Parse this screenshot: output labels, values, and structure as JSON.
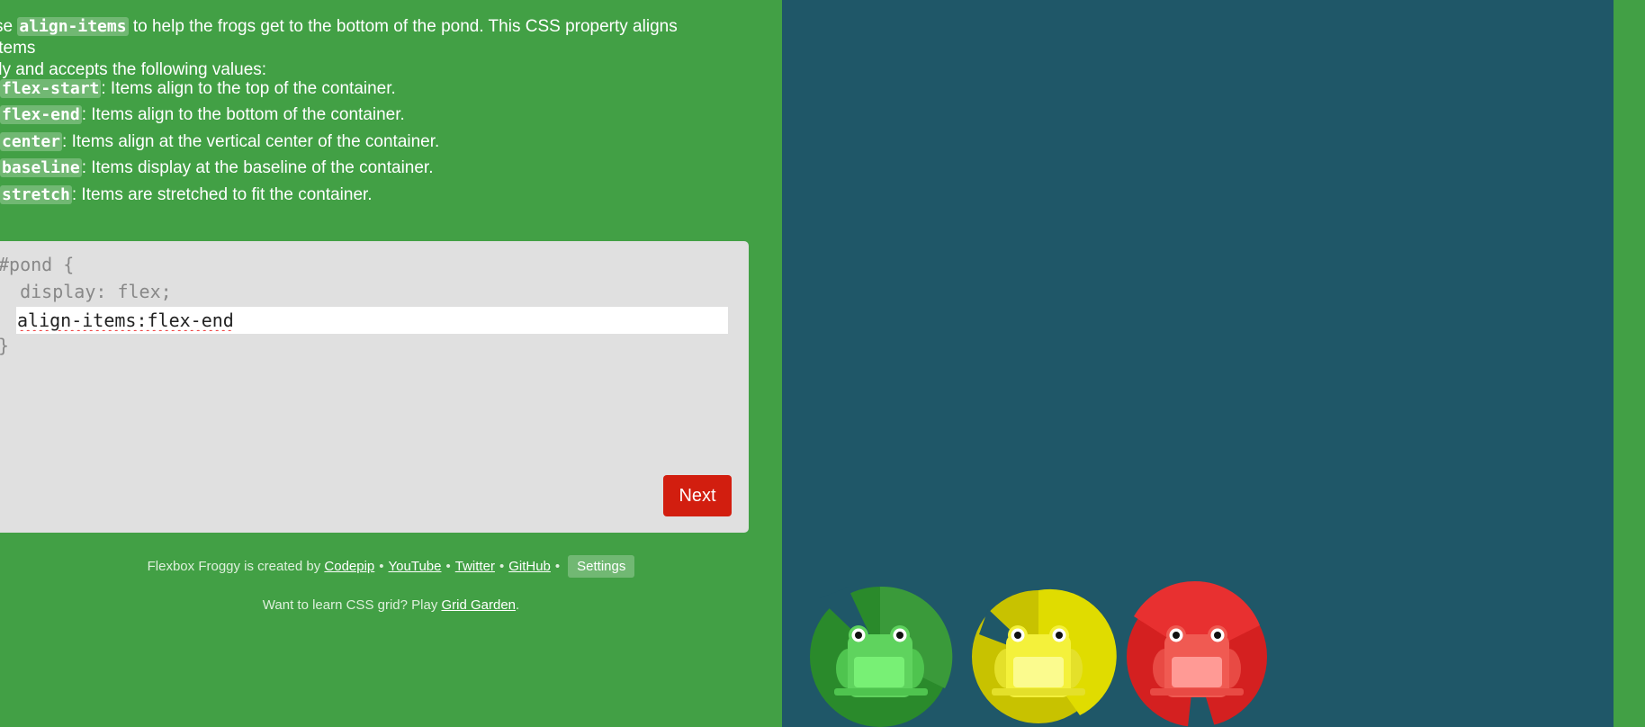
{
  "instructions": {
    "pre": "se ",
    "property": "align-items",
    "post": " to help the frogs get to the bottom of the pond. This CSS property aligns items",
    "line2": "lly and accepts the following values:"
  },
  "values": [
    {
      "code": "flex-start",
      "desc": ": Items align to the top of the container."
    },
    {
      "code": "flex-end",
      "desc": ": Items align to the bottom of the container."
    },
    {
      "code": "center",
      "desc": ": Items align at the vertical center of the container."
    },
    {
      "code": "baseline",
      "desc": ": Items display at the baseline of the container."
    },
    {
      "code": "stretch",
      "desc": ": Items are stretched to fit the container."
    }
  ],
  "editor": {
    "line1": "#pond {",
    "line2": "  display: flex;",
    "input_value": "align-items:flex-end",
    "closing": "}",
    "next_label": "Next"
  },
  "footer": {
    "credit_prefix": "Flexbox Froggy is created by ",
    "links": [
      "Codepip",
      "YouTube",
      "Twitter",
      "GitHub"
    ],
    "separator": "•",
    "settings_label": "Settings",
    "grid_prefix": "Want to learn CSS grid? Play ",
    "grid_link": "Grid Garden",
    "grid_suffix": "."
  },
  "colors": {
    "sidebar_bg": "#42a045",
    "pond_bg": "#1f5768",
    "next_button": "#d21e0f",
    "frog_green": "#5fd35e",
    "frog_yellow": "#f4f13b",
    "frog_red": "#f05a52"
  }
}
